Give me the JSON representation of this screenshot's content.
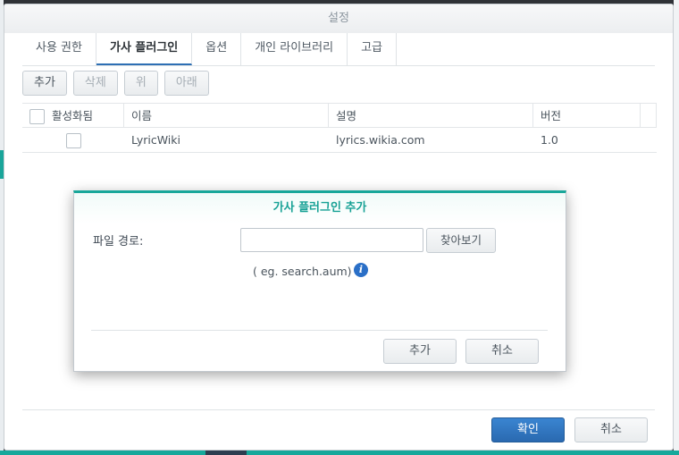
{
  "window": {
    "title": "설정"
  },
  "tabs": [
    {
      "label": "사용 권한"
    },
    {
      "label": "가사 플러그인",
      "active": true
    },
    {
      "label": "옵션"
    },
    {
      "label": "개인 라이브러리"
    },
    {
      "label": "고급"
    }
  ],
  "toolbar": {
    "add": "추가",
    "delete": "삭제",
    "up": "위",
    "down": "아래"
  },
  "grid": {
    "headers": {
      "enabled": "활성화됨",
      "name": "이름",
      "description": "설명",
      "version": "버전"
    },
    "rows": [
      {
        "name": "LyricWiki",
        "description": "lyrics.wikia.com",
        "version": "1.0"
      }
    ]
  },
  "footer": {
    "ok": "확인",
    "cancel": "취소"
  },
  "modal": {
    "title": "가사 플러그인 추가",
    "file_path_label": "파일 경로:",
    "file_path_value": "",
    "browse": "찾아보기",
    "hint": "( eg. search.aum)",
    "add": "추가",
    "cancel": "취소"
  },
  "colors": {
    "accent_teal": "#18a79a",
    "primary_blue": "#2e6fb4"
  }
}
